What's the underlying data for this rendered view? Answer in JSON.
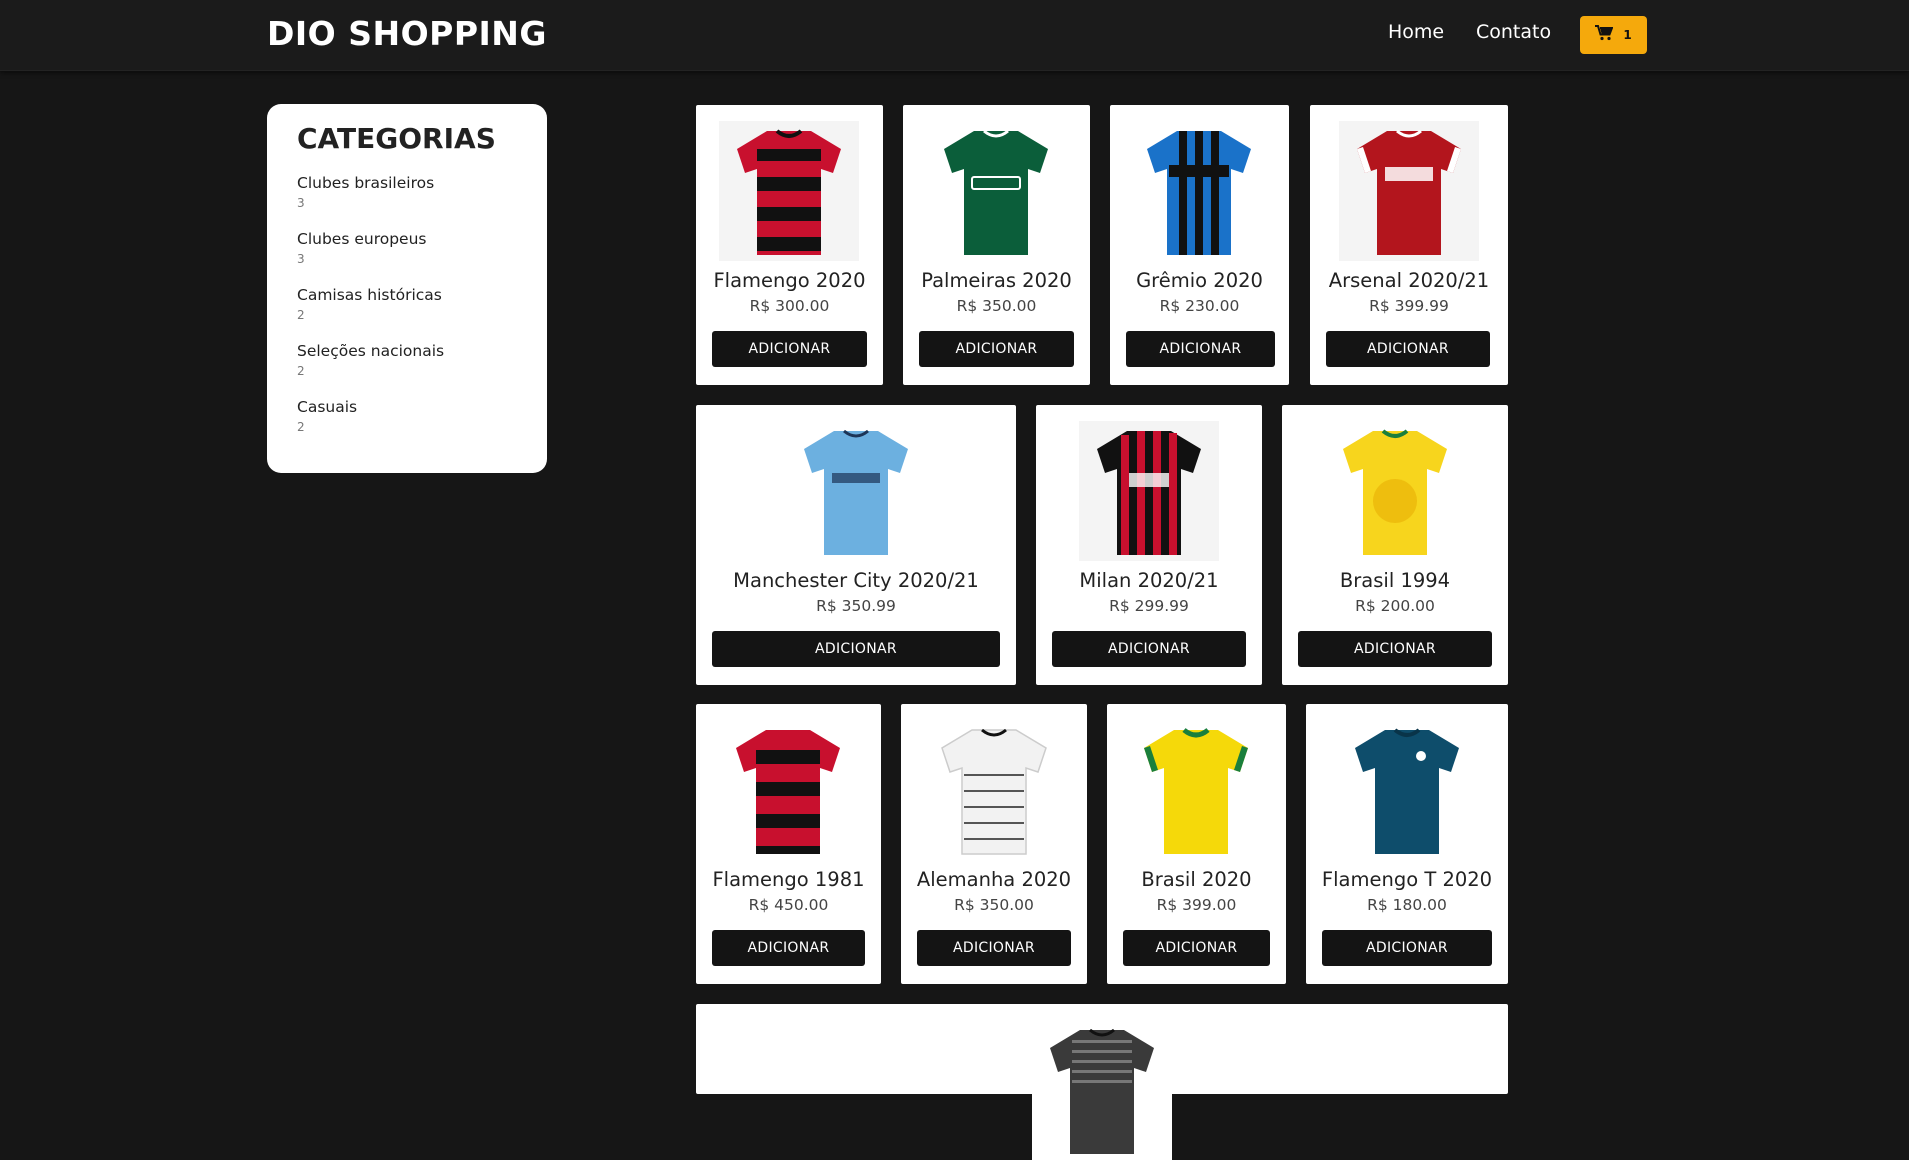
{
  "header": {
    "brand": "DIO SHOPPING",
    "nav": [
      "Home",
      "Contato"
    ],
    "cart_count": "1"
  },
  "sidebar": {
    "title": "CATEGORIAS",
    "categories": [
      {
        "name": "Clubes brasileiros",
        "count": "3"
      },
      {
        "name": "Clubes europeus",
        "count": "3"
      },
      {
        "name": "Camisas históricas",
        "count": "2"
      },
      {
        "name": "Seleções nacionais",
        "count": "2"
      },
      {
        "name": "Casuais",
        "count": "2"
      }
    ]
  },
  "products": [
    {
      "name": "Flamengo 2020",
      "price": "R$ 300.00",
      "button": "ADICIONAR"
    },
    {
      "name": "Palmeiras 2020",
      "price": "R$ 350.00",
      "button": "ADICIONAR"
    },
    {
      "name": "Grêmio 2020",
      "price": "R$ 230.00",
      "button": "ADICIONAR"
    },
    {
      "name": "Arsenal 2020/21",
      "price": "R$ 399.99",
      "button": "ADICIONAR"
    },
    {
      "name": "Manchester City 2020/21",
      "price": "R$ 350.99",
      "button": "ADICIONAR"
    },
    {
      "name": "Milan 2020/21",
      "price": "R$ 299.99",
      "button": "ADICIONAR"
    },
    {
      "name": "Brasil 1994",
      "price": "R$ 200.00",
      "button": "ADICIONAR"
    },
    {
      "name": "Flamengo 1981",
      "price": "R$ 450.00",
      "button": "ADICIONAR"
    },
    {
      "name": "Alemanha 2020",
      "price": "R$ 350.00",
      "button": "ADICIONAR"
    },
    {
      "name": "Brasil 2020",
      "price": "R$ 399.00",
      "button": "ADICIONAR"
    },
    {
      "name": "Flamengo T 2020",
      "price": "R$ 180.00",
      "button": "ADICIONAR"
    }
  ],
  "colors": {
    "background": "#161616",
    "navbar": "#1b1b1b",
    "cart_button": "#f5a90c",
    "add_button": "#141414",
    "card": "#ffffff"
  },
  "icons": {
    "cart": "shopping-cart-icon"
  }
}
